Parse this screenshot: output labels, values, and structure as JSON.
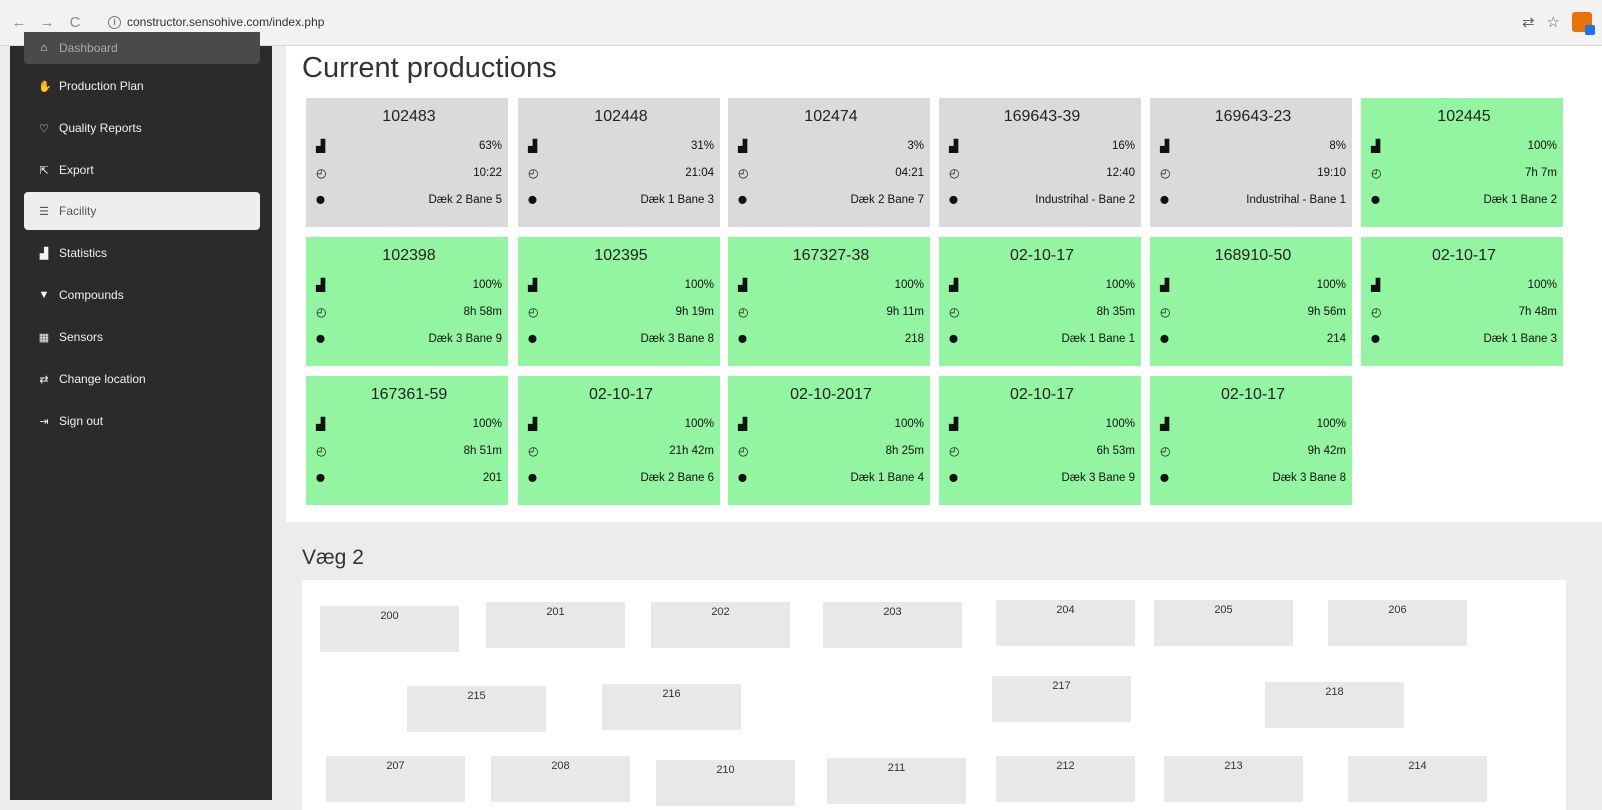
{
  "browser": {
    "back": "←",
    "forward": "→",
    "reload": "C",
    "url": "constructor.sensohive.com/index.php",
    "icons": [
      "translate-icon",
      "star-icon",
      "extension-icon"
    ]
  },
  "sidebar": {
    "items": [
      {
        "label": "Dashboard",
        "icon": "home-icon"
      },
      {
        "label": "Production Plan",
        "icon": "hand-icon"
      },
      {
        "label": "Quality Reports",
        "icon": "heart-icon"
      },
      {
        "label": "Export",
        "icon": "export-icon"
      },
      {
        "label": "Facility",
        "icon": "list-icon"
      },
      {
        "label": "Statistics",
        "icon": "stats-icon"
      },
      {
        "label": "Compounds",
        "icon": "filter-icon"
      },
      {
        "label": "Sensors",
        "icon": "grid-icon"
      },
      {
        "label": "Change location",
        "icon": "swap-icon"
      },
      {
        "label": "Sign out",
        "icon": "signout-icon"
      }
    ]
  },
  "main": {
    "title": "Current productions",
    "cards": [
      {
        "id": "102483",
        "pct": "63%",
        "time": "10:22",
        "loc": "Dæk 2 Bane 5",
        "status": "grey"
      },
      {
        "id": "102448",
        "pct": "31%",
        "time": "21:04",
        "loc": "Dæk 1 Bane 3",
        "status": "grey"
      },
      {
        "id": "102474",
        "pct": "3%",
        "time": "04:21",
        "loc": "Dæk 2 Bane 7",
        "status": "grey"
      },
      {
        "id": "169643-39",
        "pct": "16%",
        "time": "12:40",
        "loc": "Industrihal - Bane 2",
        "status": "grey"
      },
      {
        "id": "169643-23",
        "pct": "8%",
        "time": "19:10",
        "loc": "Industrihal - Bane 1",
        "status": "grey"
      },
      {
        "id": "102445",
        "pct": "100%",
        "time": "7h 7m",
        "loc": "Dæk 1 Bane 2",
        "status": "green"
      },
      {
        "id": "102398",
        "pct": "100%",
        "time": "8h 58m",
        "loc": "Dæk 3 Bane 9",
        "status": "green"
      },
      {
        "id": "102395",
        "pct": "100%",
        "time": "9h 19m",
        "loc": "Dæk 3 Bane 8",
        "status": "green"
      },
      {
        "id": "167327-38",
        "pct": "100%",
        "time": "9h 11m",
        "loc": "218",
        "status": "green"
      },
      {
        "id": "02-10-17",
        "pct": "100%",
        "time": "8h 35m",
        "loc": "Dæk 1 Bane 1",
        "status": "green"
      },
      {
        "id": "168910-50",
        "pct": "100%",
        "time": "9h 56m",
        "loc": "214",
        "status": "green"
      },
      {
        "id": "02-10-17",
        "pct": "100%",
        "time": "7h 48m",
        "loc": "Dæk 1 Bane 3",
        "status": "green"
      },
      {
        "id": "167361-59",
        "pct": "100%",
        "time": "8h 51m",
        "loc": "201",
        "status": "green"
      },
      {
        "id": "02-10-17",
        "pct": "100%",
        "time": "21h 42m",
        "loc": "Dæk 2 Bane 6",
        "status": "green"
      },
      {
        "id": "02-10-2017",
        "pct": "100%",
        "time": "8h 25m",
        "loc": "Dæk 1 Bane 4",
        "status": "green"
      },
      {
        "id": "02-10-17",
        "pct": "100%",
        "time": "6h 53m",
        "loc": "Dæk 3 Bane 9",
        "status": "green"
      },
      {
        "id": "02-10-17",
        "pct": "100%",
        "time": "9h 42m",
        "loc": "Dæk 3 Bane 8",
        "status": "green"
      }
    ]
  },
  "wall": {
    "title": "Væg 2",
    "lanes": [
      "200",
      "201",
      "202",
      "203",
      "204",
      "205",
      "206",
      "215",
      "216",
      "217",
      "218",
      "207",
      "208",
      "210",
      "211",
      "212",
      "213",
      "214"
    ]
  },
  "colors": {
    "grey_card": "#dadada",
    "green_card": "#93f5a1",
    "sidebar": "#2b2b2b"
  }
}
